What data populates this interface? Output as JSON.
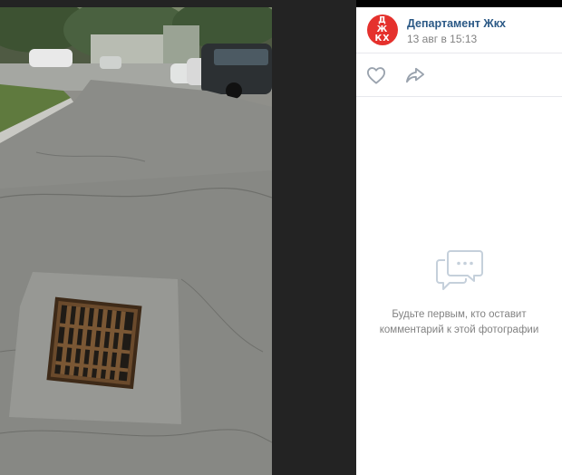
{
  "post": {
    "author_name": "Департамент Жкх",
    "avatar_text": "ДЖКХ",
    "date": "13 авг в 15:13"
  },
  "actions": {
    "like_icon": "heart-icon",
    "share_icon": "share-arrow-icon"
  },
  "comments": {
    "empty_icon": "comments-bubble-icon",
    "empty_text": "Будьте первым, кто оставит комментарий к этой фотографии"
  },
  "colors": {
    "avatar_bg": "#e5312d",
    "link": "#2a5885",
    "muted": "#828282"
  }
}
